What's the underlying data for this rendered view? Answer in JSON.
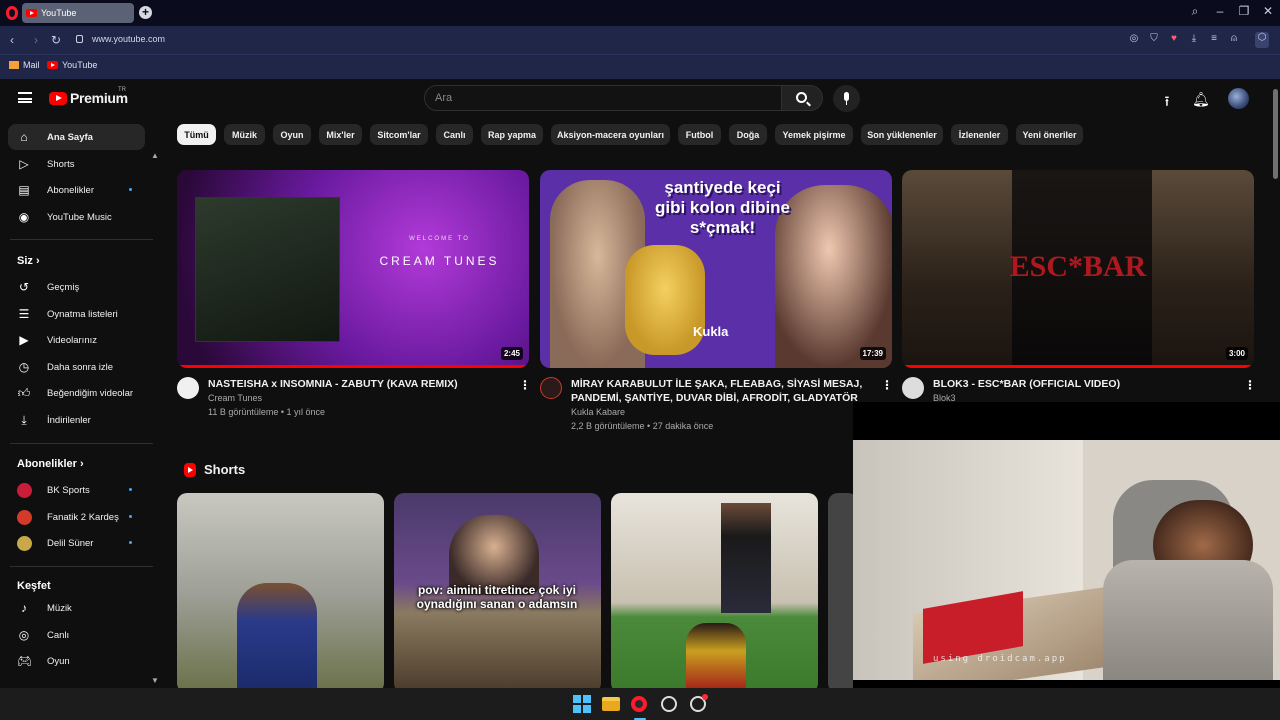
{
  "browser": {
    "tab_title": "YouTube",
    "url": "www.youtube.com",
    "bookmarks": [
      "Mail",
      "YouTube"
    ]
  },
  "masthead": {
    "logo_text": "Premium",
    "region": "TR",
    "search_placeholder": "Ara"
  },
  "sidebar": {
    "main": [
      {
        "label": "Ana Sayfa",
        "icon": "home-icon"
      },
      {
        "label": "Shorts",
        "icon": "shorts-icon"
      },
      {
        "label": "Abonelikler",
        "icon": "subscriptions-icon"
      },
      {
        "label": "YouTube Music",
        "icon": "music-icon"
      }
    ],
    "you_heading": "Siz",
    "you": [
      {
        "label": "Geçmiş",
        "icon": "history-icon"
      },
      {
        "label": "Oynatma listeleri",
        "icon": "playlist-icon"
      },
      {
        "label": "Videolarınız",
        "icon": "your-videos-icon"
      },
      {
        "label": "Daha sonra izle",
        "icon": "watch-later-icon"
      },
      {
        "label": "Beğendiğim videolar",
        "icon": "like-icon"
      },
      {
        "label": "İndirilenler",
        "icon": "download-icon"
      }
    ],
    "subs_heading": "Abonelikler",
    "subs": [
      {
        "label": "BK Sports",
        "color": "#c81e3a"
      },
      {
        "label": "Fanatik 2 Kardeş",
        "color": "#d43a2a"
      },
      {
        "label": "Delil Süner",
        "color": "#c8a848"
      }
    ],
    "explore_heading": "Keşfet",
    "explore": [
      {
        "label": "Müzik",
        "icon": "music-note-icon"
      },
      {
        "label": "Canlı",
        "icon": "live-icon"
      },
      {
        "label": "Oyun",
        "icon": "gaming-icon"
      }
    ]
  },
  "chips": [
    "Tümü",
    "Müzik",
    "Oyun",
    "Mix'ler",
    "Sitcom'lar",
    "Canlı",
    "Rap yapma",
    "Aksiyon-macera oyunları",
    "Futbol",
    "Doğa",
    "Yemek pişirme",
    "Son yüklenenler",
    "İzlenenler",
    "Yeni öneriler"
  ],
  "videos": [
    {
      "title": "NASTEISHA x INSOMNIA - ZABUTY (KAVA REMIX)",
      "channel": "Cream Tunes",
      "stats": "11 B görüntüleme • 1 yıl önce",
      "duration": "2:45",
      "thumb_text": "CREAM TUNES",
      "thumb_small": "WELCOME TO",
      "watched_fraction": 1.0
    },
    {
      "title": "MİRAY KARABULUT İLE ŞAKA, FLEABAG, SİYASİ MESAJ, PANDEMİ, ŞANTİYE, DUVAR DİBİ, AFRODİT, GLADYATÖR",
      "channel": "Kukla Kabare",
      "stats": "2,2 B görüntüleme • 27 dakika önce",
      "duration": "17:39",
      "thumb_text": "şantiyede keçi gibi kolon dibine s*çmak!",
      "thumb_brand": "Kukla",
      "watched_fraction": 0.0
    },
    {
      "title": "BLOK3 - ESC*BAR (OFFICIAL VIDEO)",
      "channel": "Blok3",
      "duration": "3:00",
      "thumb_text": "ESC*BAR",
      "watched_fraction": 1.0
    }
  ],
  "shorts": {
    "heading": "Shorts",
    "items": [
      {
        "caption": ""
      },
      {
        "caption": "pov: aimini titretince çok iyi oynadığını sanan o adamsın"
      },
      {
        "caption": ""
      }
    ]
  },
  "webcam": {
    "watermark": "using droidcam.app"
  }
}
